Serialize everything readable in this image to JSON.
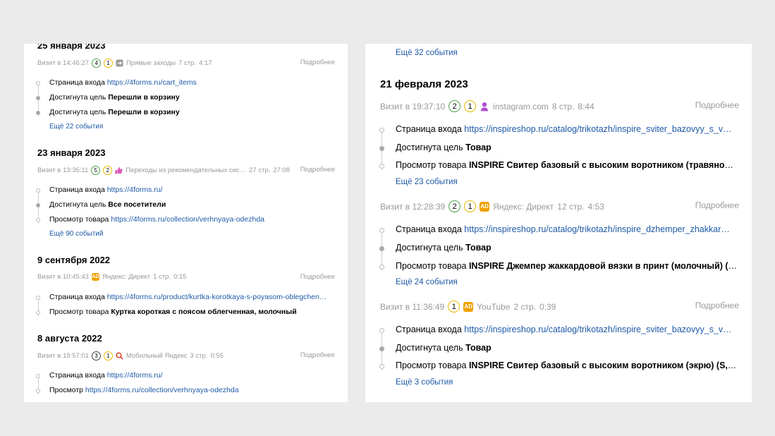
{
  "left": {
    "visits": [
      {
        "date": "25 января 2023",
        "time": "Визит в 14:46:27",
        "badges": [
          "4",
          "1"
        ],
        "source_icon": "direct-visits-icon",
        "source": "Прямые заходы",
        "pages": "7 стр.",
        "duration": "4:17",
        "details": "Подробнее",
        "events": [
          {
            "label": "Страница входа",
            "link": "https://4forms.ru/cart_items"
          },
          {
            "label": "Достигнута цель",
            "bold": "Перешли в корзину"
          },
          {
            "label": "Достигнута цель",
            "bold": "Перешли в корзину"
          }
        ],
        "more_events": "Ещё 22 события"
      },
      {
        "date": "23 января 2023",
        "time": "Визит в 13:35:11",
        "badges": [
          "5",
          "2"
        ],
        "source_icon": "thumbs-up-icon",
        "source": "Переходы из рекомендательных сис…",
        "pages": "27 стр.",
        "duration": "27:08",
        "details": "Подробнее",
        "events": [
          {
            "label": "Страница входа",
            "link": "https://4forms.ru/"
          },
          {
            "label": "Достигнута цель",
            "bold": "Все посетители"
          },
          {
            "label": "Просмотр товара",
            "link": "https://4forms.ru/collection/verhnyaya-odezhda"
          }
        ],
        "more_events": "Ещё 90 событий"
      },
      {
        "date": "9 сентября 2022",
        "time": "Визит в 10:45:43",
        "badges": [],
        "source_icon": "ad-icon",
        "source_icon_text": "AD",
        "source": "Яндекс: Директ",
        "pages": "1 стр.",
        "duration": "0:15",
        "details": "Подробнее",
        "events": [
          {
            "label": "Страница входа",
            "link": "https://4forms.ru/product/kurtka-korotkaya-s-poyasom-oblegchen…"
          },
          {
            "label": "Просмотр товара",
            "bold": "Куртка короткая с поясом облегченная, молочный"
          }
        ],
        "more_events": ""
      },
      {
        "date": "8 августа 2022",
        "time": "Визит в 19:57:01",
        "badges": [
          "3",
          "1"
        ],
        "source_icon": "search-icon",
        "source": "Мобильный Яндекс",
        "pages": "3 стр.",
        "duration": "0:55",
        "details": "Подробнее",
        "events": [
          {
            "label": "Страница входа",
            "link": "https://4forms.ru/"
          },
          {
            "label": "Просмотр",
            "link": "https://4forms.ru/collection/verhnyaya-odezhda"
          }
        ],
        "more_events": ""
      }
    ]
  },
  "right": {
    "top_more_events": "Ещё 32 события",
    "date": "21 февраля 2023",
    "visits": [
      {
        "time": "Визит в 19:37:10",
        "badges": [
          "2",
          "1"
        ],
        "source_icon": "instagram-icon",
        "source": "instagram.com",
        "pages": "8 стр.",
        "duration": "8:44",
        "details": "Подробнее",
        "events": [
          {
            "label": "Страница входа",
            "link": "https://inspireshop.ru/catalog/trikotazh/inspire_sviter_bazovyy_s_v…"
          },
          {
            "label": "Достигнута цель",
            "bold": "Товар"
          },
          {
            "label": "Просмотр товара",
            "bold": "INSPIRE Свитер базовый с высоким воротником (травяной) (S, …"
          }
        ],
        "more_events": "Ещё 23 события"
      },
      {
        "time": "Визит в 12:28:39",
        "badges": [
          "2",
          "1"
        ],
        "source_icon": "ad-icon",
        "source_icon_text": "AD",
        "source": "Яндекс: Директ",
        "pages": "12 стр.",
        "duration": "4:53",
        "details": "Подробнее",
        "events": [
          {
            "label": "Страница входа",
            "link": "https://inspireshop.ru/catalog/trikotazh/inspire_dzhemper_zhakkar…"
          },
          {
            "label": "Достигнута цель",
            "bold": "Товар"
          },
          {
            "label": "Просмотр товара",
            "bold": "INSPIRE Джемпер жаккардовой вязки в принт (молочный) (One…"
          }
        ],
        "more_events": "Ещё 24 события"
      },
      {
        "time": "Визит в 11:36:49",
        "badges": [
          "1"
        ],
        "source_icon": "ad-icon",
        "source_icon_text": "AD",
        "source": "YouTube",
        "pages": "2 стр.",
        "duration": "0:39",
        "details": "Подробнее",
        "events": [
          {
            "label": "Страница входа",
            "link": "https://inspireshop.ru/catalog/trikotazh/inspire_sviter_bazovyy_s_v…"
          },
          {
            "label": "Достигнута цель",
            "bold": "Товар"
          },
          {
            "label": "Просмотр товара",
            "bold": "INSPIRE Свитер базовый с высоким воротником (экрю) (S, Экрю)"
          }
        ],
        "more_events": "Ещё 3 события"
      }
    ]
  },
  "colors": {
    "background": "#ebebeb",
    "link": "#1e5aa8",
    "muted": "#999999",
    "badge_green": "#4aa14a",
    "badge_yellow": "#e8b800",
    "ad_orange": "#f0a000"
  }
}
